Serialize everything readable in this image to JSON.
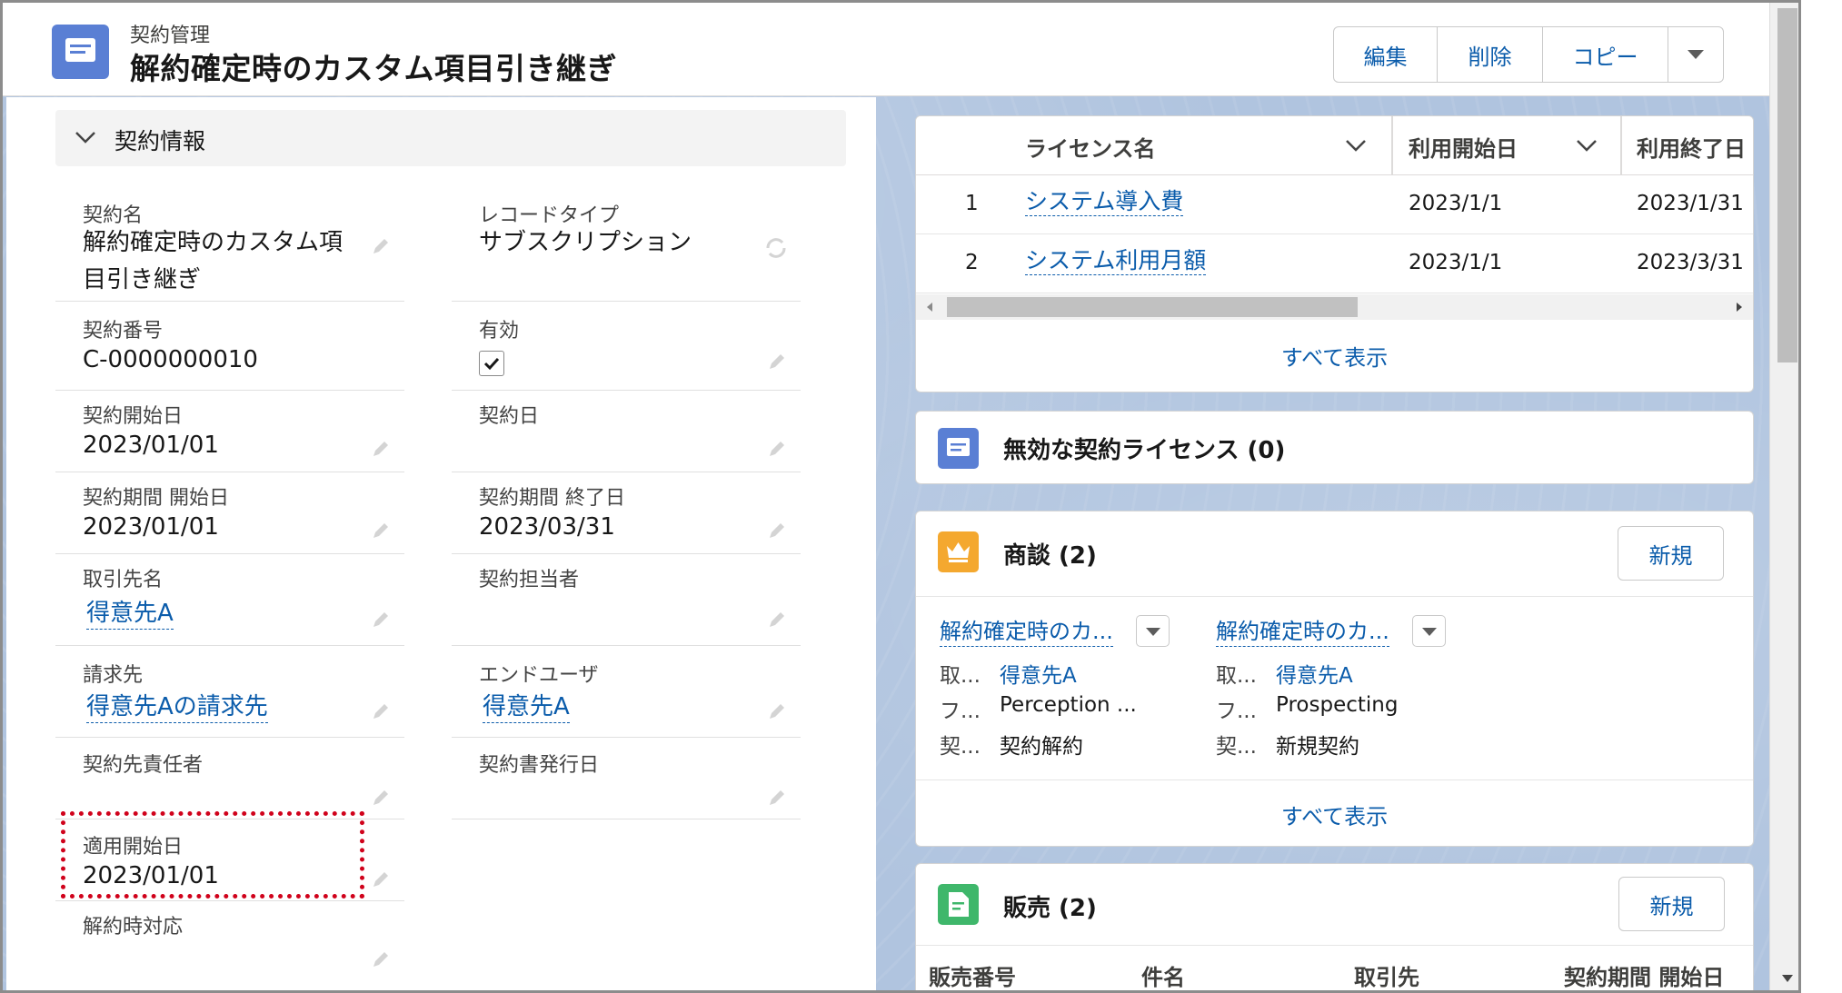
{
  "header": {
    "object_label": "契約管理",
    "record_title": "解約確定時のカスタム項目引き継ぎ",
    "icon": "contract-icon",
    "accent": "#5a7fd4",
    "actions": [
      "編集",
      "削除",
      "コピー"
    ]
  },
  "details": {
    "section_label": "契約情報",
    "fields": {
      "contract_name": {
        "label": "契約名",
        "value_line1": "解約確定時のカスタム項",
        "value_line2": "目引き継ぎ"
      },
      "record_type": {
        "label": "レコードタイプ",
        "value": "サブスクリプション"
      },
      "contract_number": {
        "label": "契約番号",
        "value": "C-0000000010"
      },
      "active": {
        "label": "有効",
        "checked": true
      },
      "contract_start": {
        "label": "契約開始日",
        "value": "2023/01/01"
      },
      "contract_date": {
        "label": "契約日",
        "value": ""
      },
      "term_start": {
        "label": "契約期間 開始日",
        "value": "2023/01/01"
      },
      "term_end": {
        "label": "契約期間 終了日",
        "value": "2023/03/31"
      },
      "account": {
        "label": "取引先名",
        "value": "得意先A"
      },
      "contact": {
        "label": "契約担当者",
        "value": ""
      },
      "bill_to": {
        "label": "請求先",
        "value": "得意先Aの請求先"
      },
      "end_user": {
        "label": "エンドユーザ",
        "value": "得意先A"
      },
      "owner": {
        "label": "契約先責任者",
        "value": ""
      },
      "issue_date": {
        "label": "契約書発行日",
        "value": ""
      },
      "apply_start": {
        "label": "適用開始日",
        "value": "2023/01/01"
      },
      "cancel_handling": {
        "label": "解約時対応",
        "value": ""
      }
    }
  },
  "licenses": {
    "columns": [
      "ライセンス名",
      "利用開始日",
      "利用終了日"
    ],
    "rows": [
      {
        "no": "1",
        "name": "システム導入費",
        "start": "2023/1/1",
        "end": "2023/1/31"
      },
      {
        "no": "2",
        "name": "システム利用月額",
        "start": "2023/1/1",
        "end": "2023/3/31"
      }
    ],
    "view_all": "すべて表示"
  },
  "inactive_licenses": {
    "title": "無効な契約ライセンス (0)",
    "color": "#5a7fd4"
  },
  "opportunities": {
    "title": "商談 (2)",
    "new_label": "新規",
    "color": "#f4a82f",
    "items": [
      {
        "name": "解約確定時のカ...",
        "k1": "取...",
        "v1": "得意先A",
        "k2": "フ...",
        "v2": "Perception ...",
        "k3": "契...",
        "v3": "契約解約"
      },
      {
        "name": "解約確定時のカ...",
        "k1": "取...",
        "v1": "得意先A",
        "k2": "フ...",
        "v2": "Prospecting",
        "k3": "契...",
        "v3": "新規契約"
      }
    ],
    "view_all": "すべて表示"
  },
  "sales": {
    "title": "販売 (2)",
    "new_label": "新規",
    "color": "#3fb76b",
    "columns": [
      "販売番号",
      "件名",
      "取引先",
      "契約期間 開始日"
    ]
  }
}
